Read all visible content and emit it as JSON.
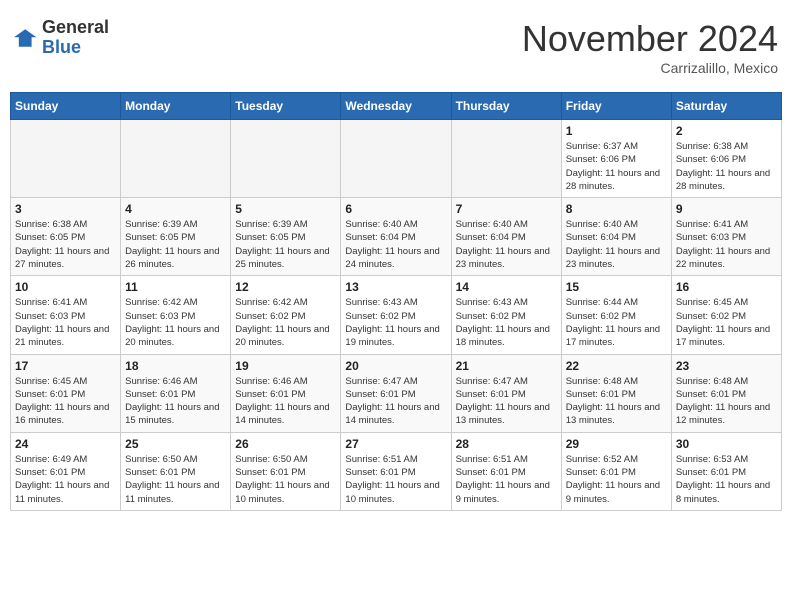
{
  "header": {
    "logo_general": "General",
    "logo_blue": "Blue",
    "month_title": "November 2024",
    "location": "Carrizalillo, Mexico"
  },
  "weekdays": [
    "Sunday",
    "Monday",
    "Tuesday",
    "Wednesday",
    "Thursday",
    "Friday",
    "Saturday"
  ],
  "weeks": [
    [
      {
        "day": "",
        "info": ""
      },
      {
        "day": "",
        "info": ""
      },
      {
        "day": "",
        "info": ""
      },
      {
        "day": "",
        "info": ""
      },
      {
        "day": "",
        "info": ""
      },
      {
        "day": "1",
        "info": "Sunrise: 6:37 AM\nSunset: 6:06 PM\nDaylight: 11 hours and 28 minutes."
      },
      {
        "day": "2",
        "info": "Sunrise: 6:38 AM\nSunset: 6:06 PM\nDaylight: 11 hours and 28 minutes."
      }
    ],
    [
      {
        "day": "3",
        "info": "Sunrise: 6:38 AM\nSunset: 6:05 PM\nDaylight: 11 hours and 27 minutes."
      },
      {
        "day": "4",
        "info": "Sunrise: 6:39 AM\nSunset: 6:05 PM\nDaylight: 11 hours and 26 minutes."
      },
      {
        "day": "5",
        "info": "Sunrise: 6:39 AM\nSunset: 6:05 PM\nDaylight: 11 hours and 25 minutes."
      },
      {
        "day": "6",
        "info": "Sunrise: 6:40 AM\nSunset: 6:04 PM\nDaylight: 11 hours and 24 minutes."
      },
      {
        "day": "7",
        "info": "Sunrise: 6:40 AM\nSunset: 6:04 PM\nDaylight: 11 hours and 23 minutes."
      },
      {
        "day": "8",
        "info": "Sunrise: 6:40 AM\nSunset: 6:04 PM\nDaylight: 11 hours and 23 minutes."
      },
      {
        "day": "9",
        "info": "Sunrise: 6:41 AM\nSunset: 6:03 PM\nDaylight: 11 hours and 22 minutes."
      }
    ],
    [
      {
        "day": "10",
        "info": "Sunrise: 6:41 AM\nSunset: 6:03 PM\nDaylight: 11 hours and 21 minutes."
      },
      {
        "day": "11",
        "info": "Sunrise: 6:42 AM\nSunset: 6:03 PM\nDaylight: 11 hours and 20 minutes."
      },
      {
        "day": "12",
        "info": "Sunrise: 6:42 AM\nSunset: 6:02 PM\nDaylight: 11 hours and 20 minutes."
      },
      {
        "day": "13",
        "info": "Sunrise: 6:43 AM\nSunset: 6:02 PM\nDaylight: 11 hours and 19 minutes."
      },
      {
        "day": "14",
        "info": "Sunrise: 6:43 AM\nSunset: 6:02 PM\nDaylight: 11 hours and 18 minutes."
      },
      {
        "day": "15",
        "info": "Sunrise: 6:44 AM\nSunset: 6:02 PM\nDaylight: 11 hours and 17 minutes."
      },
      {
        "day": "16",
        "info": "Sunrise: 6:45 AM\nSunset: 6:02 PM\nDaylight: 11 hours and 17 minutes."
      }
    ],
    [
      {
        "day": "17",
        "info": "Sunrise: 6:45 AM\nSunset: 6:01 PM\nDaylight: 11 hours and 16 minutes."
      },
      {
        "day": "18",
        "info": "Sunrise: 6:46 AM\nSunset: 6:01 PM\nDaylight: 11 hours and 15 minutes."
      },
      {
        "day": "19",
        "info": "Sunrise: 6:46 AM\nSunset: 6:01 PM\nDaylight: 11 hours and 14 minutes."
      },
      {
        "day": "20",
        "info": "Sunrise: 6:47 AM\nSunset: 6:01 PM\nDaylight: 11 hours and 14 minutes."
      },
      {
        "day": "21",
        "info": "Sunrise: 6:47 AM\nSunset: 6:01 PM\nDaylight: 11 hours and 13 minutes."
      },
      {
        "day": "22",
        "info": "Sunrise: 6:48 AM\nSunset: 6:01 PM\nDaylight: 11 hours and 13 minutes."
      },
      {
        "day": "23",
        "info": "Sunrise: 6:48 AM\nSunset: 6:01 PM\nDaylight: 11 hours and 12 minutes."
      }
    ],
    [
      {
        "day": "24",
        "info": "Sunrise: 6:49 AM\nSunset: 6:01 PM\nDaylight: 11 hours and 11 minutes."
      },
      {
        "day": "25",
        "info": "Sunrise: 6:50 AM\nSunset: 6:01 PM\nDaylight: 11 hours and 11 minutes."
      },
      {
        "day": "26",
        "info": "Sunrise: 6:50 AM\nSunset: 6:01 PM\nDaylight: 11 hours and 10 minutes."
      },
      {
        "day": "27",
        "info": "Sunrise: 6:51 AM\nSunset: 6:01 PM\nDaylight: 11 hours and 10 minutes."
      },
      {
        "day": "28",
        "info": "Sunrise: 6:51 AM\nSunset: 6:01 PM\nDaylight: 11 hours and 9 minutes."
      },
      {
        "day": "29",
        "info": "Sunrise: 6:52 AM\nSunset: 6:01 PM\nDaylight: 11 hours and 9 minutes."
      },
      {
        "day": "30",
        "info": "Sunrise: 6:53 AM\nSunset: 6:01 PM\nDaylight: 11 hours and 8 minutes."
      }
    ]
  ]
}
